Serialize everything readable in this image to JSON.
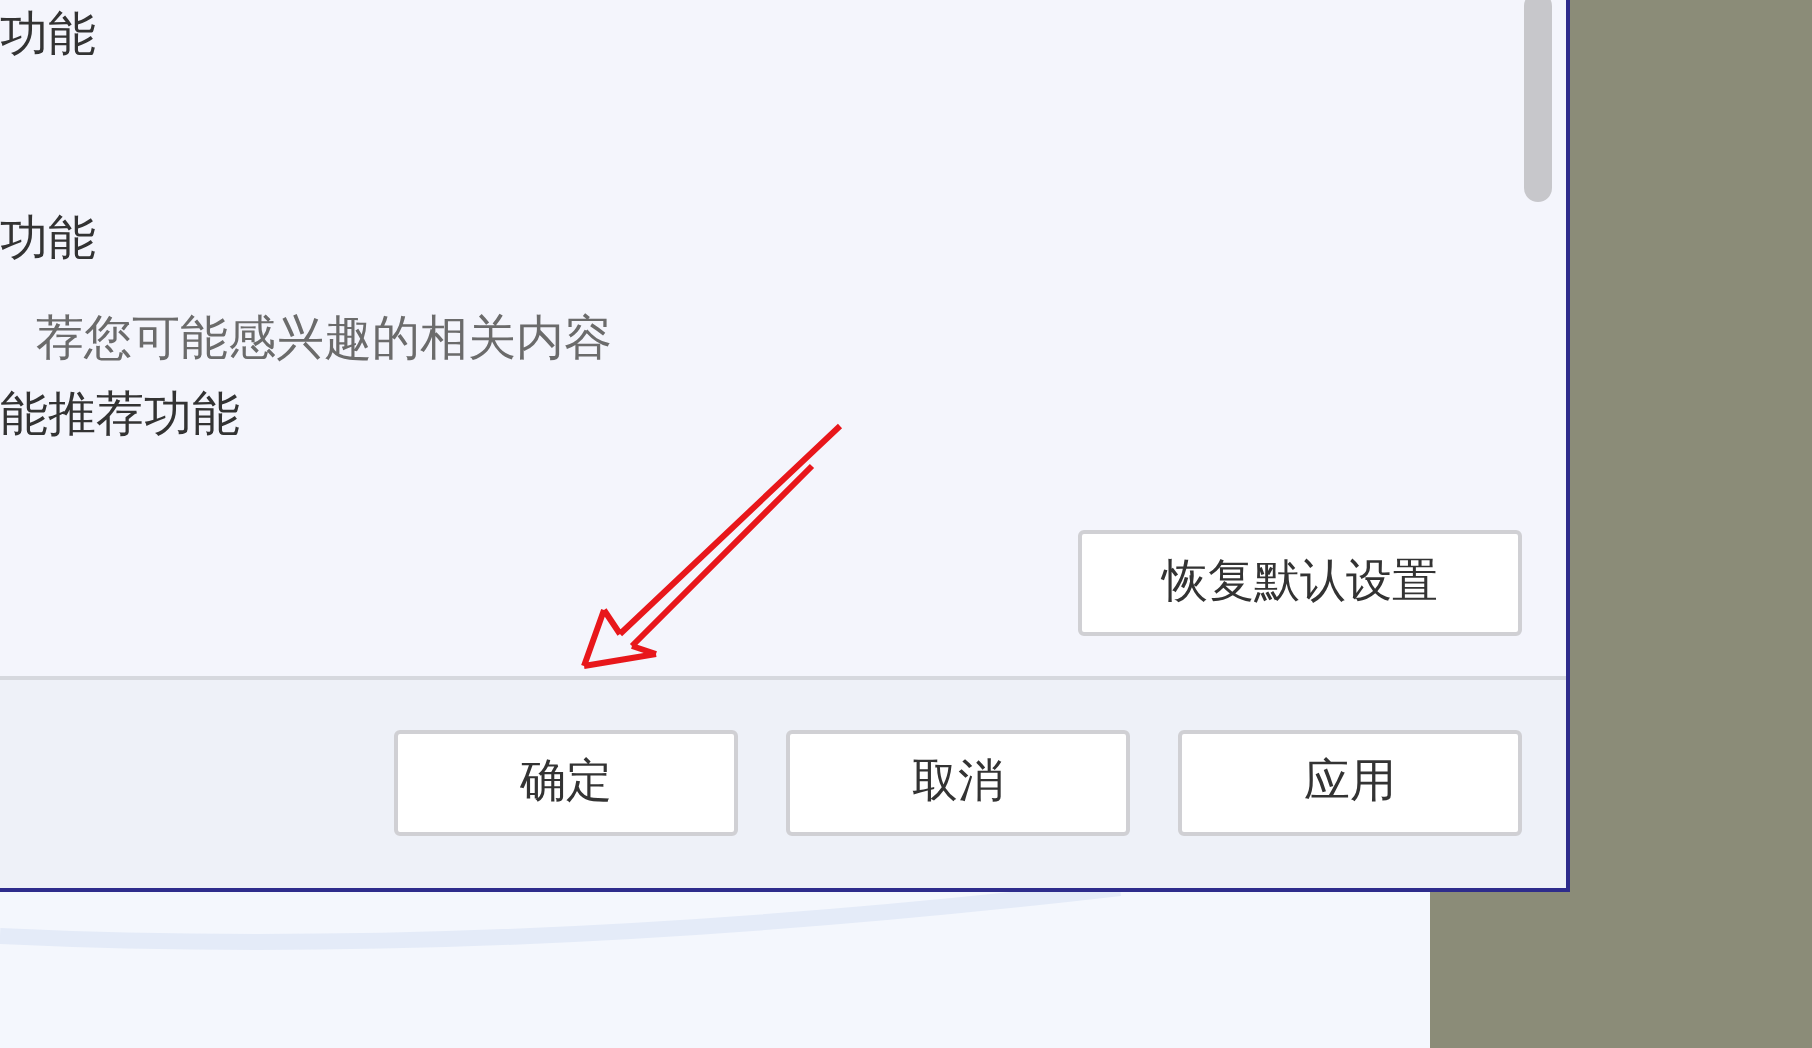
{
  "settings_panel": {
    "lines": [
      {
        "text": "功能",
        "kind": "heading"
      },
      {
        "text": "功能",
        "kind": "heading"
      },
      {
        "text": "荐您可能感兴趣的相关内容",
        "kind": "description"
      },
      {
        "text": "能推荐功能",
        "kind": "heading"
      }
    ],
    "restore_button": "恢复默认设置"
  },
  "footer_buttons": [
    "确定",
    "取消",
    "应用"
  ]
}
